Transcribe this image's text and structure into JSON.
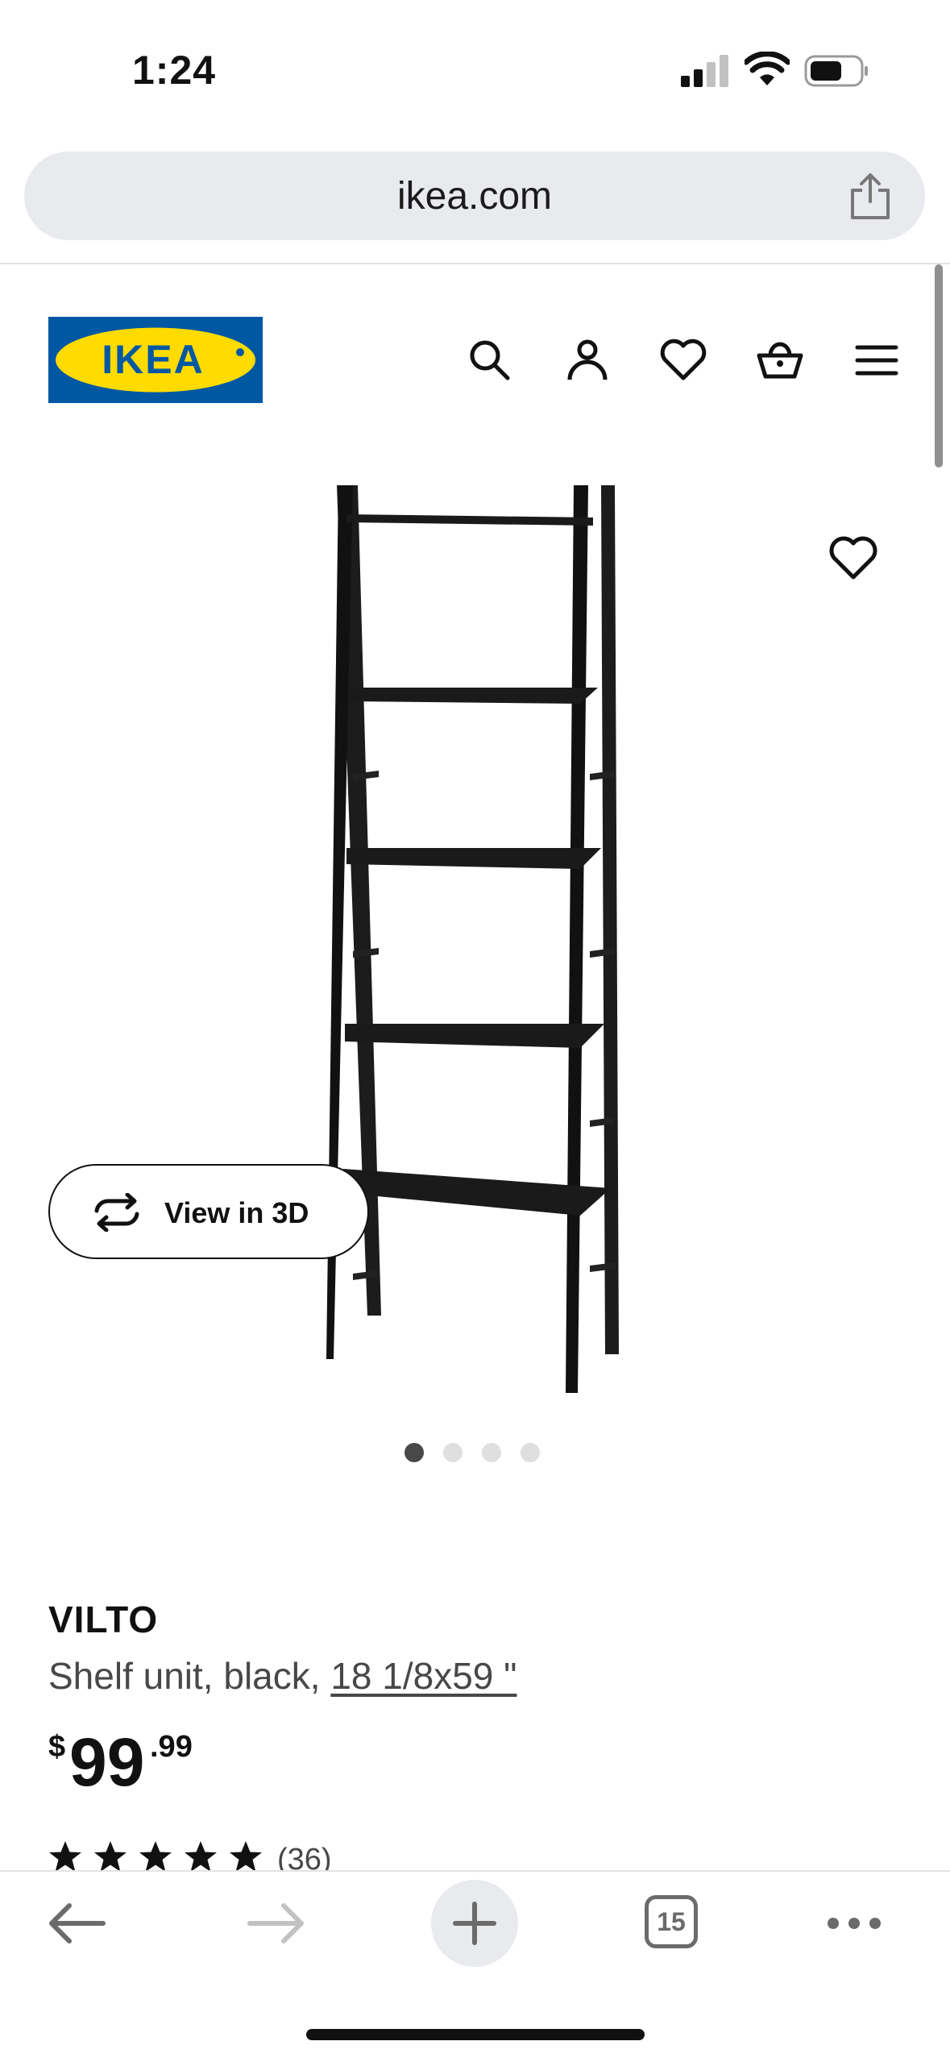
{
  "status_bar": {
    "time": "1:24"
  },
  "browser": {
    "url": "ikea.com",
    "tab_count": "15"
  },
  "site": {
    "logo_text": "IKEA",
    "brand_colors": {
      "blue": "#0058A3",
      "yellow": "#FFDB00"
    }
  },
  "header_icons": [
    "search-icon",
    "account-icon",
    "heart-icon",
    "basket-icon",
    "menu-icon"
  ],
  "gallery": {
    "view_3d_label": "View in 3D",
    "image_count": 4,
    "active_index": 0
  },
  "product": {
    "name": "VILTO",
    "description": "Shelf unit, black, ",
    "size": "18 1/8x59 \"",
    "price_currency": "$",
    "price_integer": "99",
    "price_decimal": ".99",
    "rating_stars": 5,
    "review_count": "(36)"
  }
}
